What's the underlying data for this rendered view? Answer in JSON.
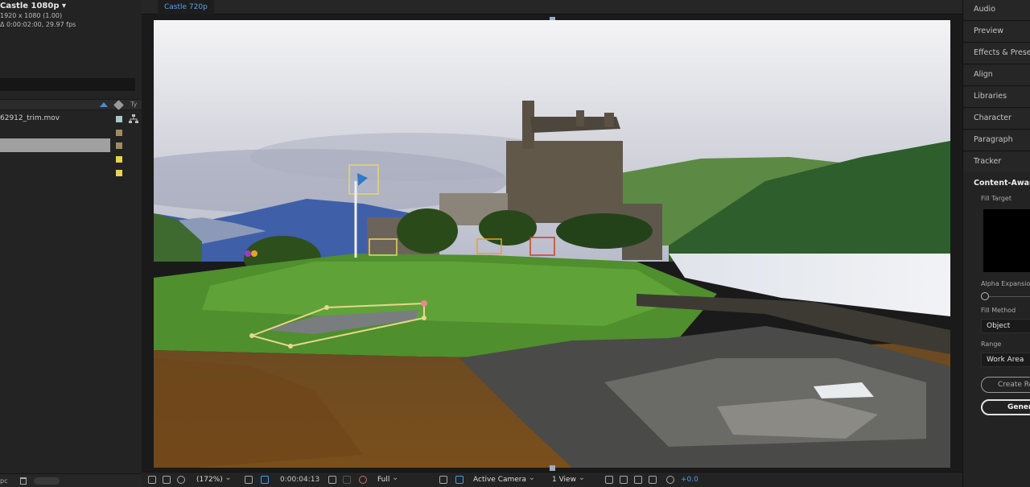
{
  "project": {
    "comp_name": "Castle 1080p ▾",
    "comp_size": "1920 x 1080 (1.00)",
    "comp_duration": "Δ 0:00:02:00, 29.97 fps",
    "type_header": "Ty",
    "items": [
      {
        "name": "62912_trim.mov",
        "color": "#a8c8c8"
      },
      {
        "name": "",
        "color": "#a08a60"
      },
      {
        "name": "",
        "color": "#a08a60"
      },
      {
        "name": "",
        "color": "#e8d44c"
      },
      {
        "name": "",
        "color": "#e8d44c"
      }
    ],
    "bpc_label": "pc"
  },
  "viewer": {
    "tab_label": "Castle 720p",
    "magnification": "(172%)",
    "timecode": "0:00:04:13",
    "resolution": "Full",
    "camera": "Active Camera",
    "views": "1 View",
    "exposure": "+0.0"
  },
  "right_panels": {
    "tabs": [
      "Audio",
      "Preview",
      "Effects & Presets",
      "Align",
      "Libraries",
      "Character",
      "Paragraph",
      "Tracker"
    ],
    "content_aware": {
      "title": "Content-Aware F",
      "fill_target_label": "Fill Target",
      "alpha_expansion_label": "Alpha Expansion",
      "fill_method_label": "Fill Method",
      "fill_method_value": "Object",
      "range_label": "Range",
      "range_value": "Work Area",
      "create_button": "Create Re",
      "generate_button": "Genera"
    }
  }
}
